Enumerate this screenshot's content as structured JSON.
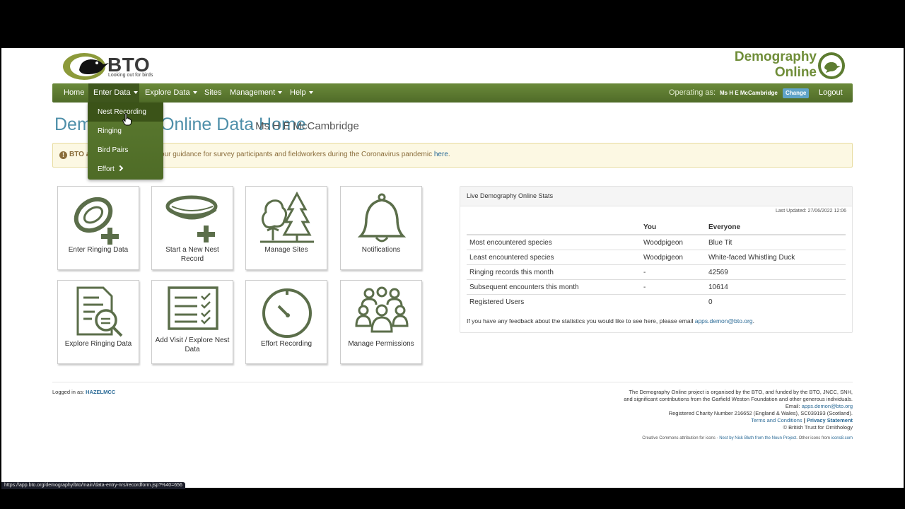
{
  "header": {
    "logo_text": "BTO",
    "logo_tagline": "Looking out for birds",
    "app_title_line1": "Demography",
    "app_title_line2": "Online"
  },
  "nav": {
    "home": "Home",
    "enter_data": "Enter Data",
    "explore_data": "Explore Data",
    "sites": "Sites",
    "management": "Management",
    "help": "Help",
    "operating_as_label": "Operating as:",
    "operating_as_user": "Ms H E McCambridge",
    "change": "Change",
    "logout": "Logout"
  },
  "dropdown": {
    "items": [
      "Nest Recording",
      "Ringing",
      "Bird Pairs",
      "Effort"
    ]
  },
  "page": {
    "title": "Demography Online Data Home",
    "subtitle": "- Ms H E McCambridge"
  },
  "alert": {
    "lead": "BTO a",
    "text": "our guidance for survey participants and fieldworkers during the Coronavirus pandemic ",
    "link": "here",
    "end": "."
  },
  "tiles": [
    {
      "label": "Enter Ringing Data"
    },
    {
      "label": "Start a New Nest Record"
    },
    {
      "label": "Manage Sites"
    },
    {
      "label": "Notifications"
    },
    {
      "label": "Explore Ringing Data"
    },
    {
      "label": "Add Visit / Explore Nest Data"
    },
    {
      "label": "Effort Recording"
    },
    {
      "label": "Manage Permissions"
    }
  ],
  "stats": {
    "title": "Live Demography Online Stats",
    "last_updated": "Last Updated: 27/06/2022 12:06",
    "col_you": "You",
    "col_everyone": "Everyone",
    "rows": [
      {
        "label": "Most encountered species",
        "you": "Woodpigeon",
        "everyone": "Blue Tit"
      },
      {
        "label": "Least encountered species",
        "you": "Woodpigeon",
        "everyone": "White-faced Whistling Duck"
      },
      {
        "label": "Ringing records this month",
        "you": "-",
        "everyone": "42569"
      },
      {
        "label": "Subsequent encounters this month",
        "you": "-",
        "everyone": "10614"
      },
      {
        "label": "Registered Users",
        "you": "",
        "everyone": "0"
      }
    ],
    "feedback_text": "If you have any feedback about the statistics you would like to see here, please email ",
    "feedback_email": "apps.demon@bto.org",
    "feedback_end": "."
  },
  "footer": {
    "logged_in_label": "Logged in as:",
    "logged_in_user": "HAZELMCC",
    "line1": "The Demography Online project is organised by the BTO, and funded by the BTO, JNCC, SNH,",
    "line2": "and significant contributions from the Garfield Weston Foundation and other generous individuals.",
    "email_label": "Email:",
    "email": "apps.demon@bto.org",
    "charity": "Registered Charity Number 216652 (England & Wales), SC039193 (Scotland).",
    "terms": "Terms and Conditions",
    "separator": "|",
    "privacy": "Privacy Statement",
    "copyright": "© British Trust for Ornithology",
    "icons_prefix": "Creative Commons attribution for icons - ",
    "icons_nest": "Nest by Nick Bluth from the Noun Project",
    "icons_mid": ". Other icons from ",
    "icons_site": "icons8.com"
  },
  "status_bar": {
    "url": "https://app.bto.org/demography/bto/main/data-entry-nrs/recordform.jsp?%40=656"
  },
  "colors": {
    "nav_green": "#5d7c31",
    "title_blue": "#4e8fa9",
    "icon_green": "#5b6e4a",
    "brand_green": "#6f8d38"
  }
}
